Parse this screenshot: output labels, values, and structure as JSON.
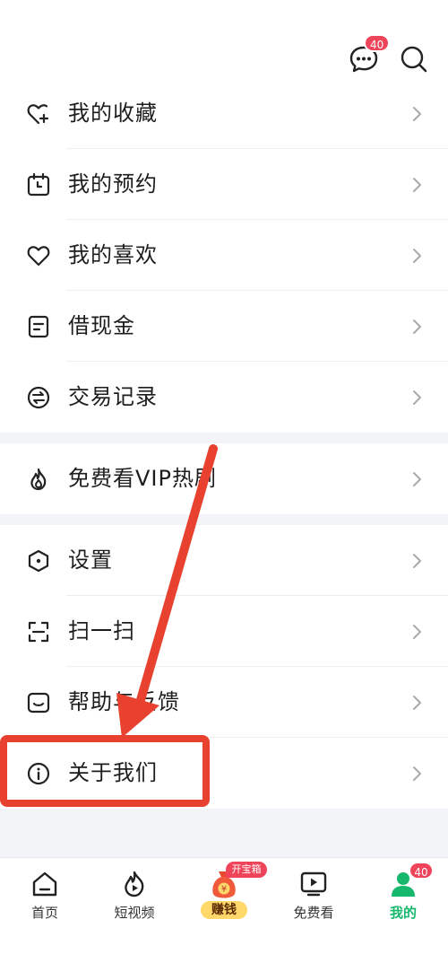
{
  "header": {
    "message_badge": "40"
  },
  "menu_group1": [
    {
      "label": "我的收藏",
      "icon": "heart-plus-icon"
    },
    {
      "label": "我的预约",
      "icon": "calendar-clock-icon"
    },
    {
      "label": "我的喜欢",
      "icon": "heart-icon"
    },
    {
      "label": "借现金",
      "icon": "card-icon"
    },
    {
      "label": "交易记录",
      "icon": "exchange-icon"
    }
  ],
  "menu_group2": [
    {
      "label": "免费看VIP热剧",
      "icon": "flame-icon"
    }
  ],
  "menu_group3": [
    {
      "label": "设置",
      "icon": "hexagon-settings-icon"
    },
    {
      "label": "扫一扫",
      "icon": "scan-icon"
    },
    {
      "label": "帮助与反馈",
      "icon": "feedback-icon"
    },
    {
      "label": "关于我们",
      "icon": "info-icon"
    }
  ],
  "tabbar": {
    "home": "首页",
    "shorts": "短视频",
    "earn": "赚钱",
    "earn_badge": "开宝箱",
    "free": "免费看",
    "me": "我的",
    "me_badge": "40"
  },
  "colors": {
    "accent": "#16b86c",
    "badge": "#f0445a",
    "annotation": "#e8412f"
  }
}
